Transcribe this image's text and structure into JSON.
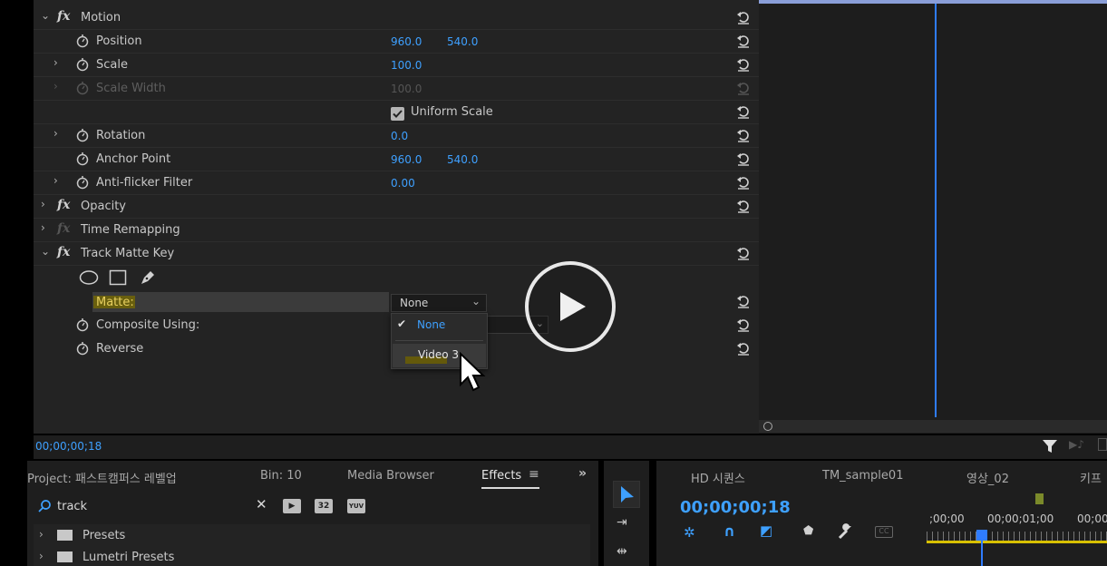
{
  "effect_controls": {
    "motion": {
      "name": "Motion",
      "position": {
        "label": "Position",
        "x": "960.0",
        "y": "540.0"
      },
      "scale": {
        "label": "Scale",
        "value": "100.0"
      },
      "scale_width": {
        "label": "Scale Width",
        "value": "100.0"
      },
      "uniform_scale": {
        "label": "Uniform Scale",
        "checked": true
      },
      "rotation": {
        "label": "Rotation",
        "value": "0.0"
      },
      "anchor_point": {
        "label": "Anchor Point",
        "x": "960.0",
        "y": "540.0"
      },
      "anti_flicker": {
        "label": "Anti-flicker Filter",
        "value": "0.00"
      }
    },
    "opacity": {
      "name": "Opacity"
    },
    "time_remapping": {
      "name": "Time Remapping"
    },
    "track_matte_key": {
      "name": "Track Matte Key",
      "matte": {
        "label": "Matte:",
        "value": "None",
        "options": [
          "None",
          "Video 3"
        ]
      },
      "composite_using": {
        "label": "Composite Using:"
      },
      "reverse": {
        "label": "Reverse"
      }
    },
    "timecode": "00;00;00;18"
  },
  "project_panel": {
    "tabs": [
      "Project: 패스트캠퍼스 레벨업",
      "Bin: 10",
      "Media Browser",
      "Effects"
    ],
    "active_tab": "Effects",
    "search_value": "track",
    "tree": [
      "Presets",
      "Lumetri Presets"
    ]
  },
  "sequence_panel": {
    "tabs": [
      "HD 시퀀스",
      "TM_sample01",
      "영상_02",
      "키프"
    ],
    "timecode": "00;00;00;18",
    "ruler": [
      ";00;00",
      "00;00;01;00",
      "00;00"
    ]
  },
  "colors": {
    "accent_blue": "#3ea0ff",
    "highlight_yellow": "#d8c000",
    "playhead": "#2f7cff"
  },
  "icons": [
    "stopwatch-icon",
    "reset-icon",
    "fx-icon",
    "play-icon",
    "cursor-icon",
    "search-icon",
    "close-icon",
    "filter-icon",
    "selection-tool-icon",
    "wrench-icon"
  ]
}
